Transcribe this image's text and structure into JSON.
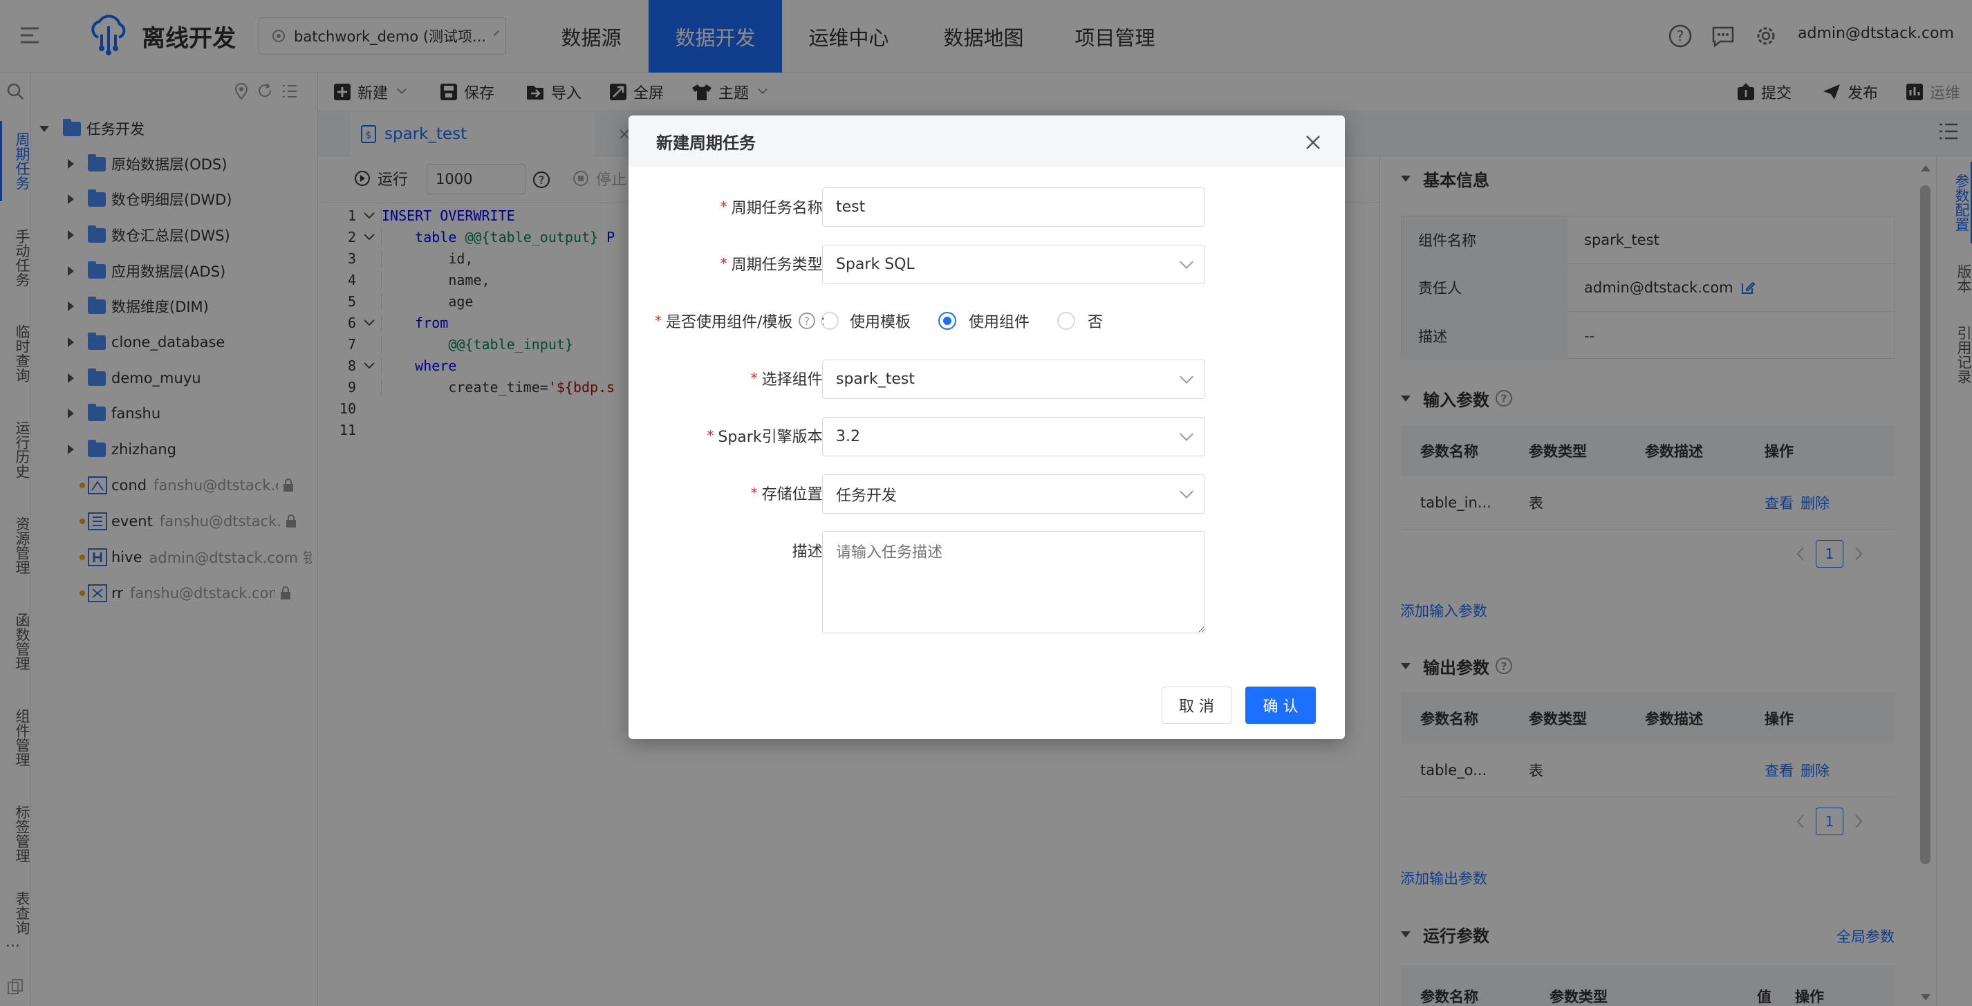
{
  "header": {
    "app_title": "离线开发",
    "project_selector": "batchwork_demo (测试项...",
    "nav": [
      {
        "label": "数据源"
      },
      {
        "label": "数据开发"
      },
      {
        "label": "运维中心"
      },
      {
        "label": "数据地图"
      },
      {
        "label": "项目管理"
      }
    ],
    "active_nav": "数据开发",
    "user": "admin@dtstack.com"
  },
  "left_rail": {
    "items": [
      {
        "label": "周期任务"
      },
      {
        "label": "手动任务"
      },
      {
        "label": "临时查询"
      },
      {
        "label": "运行历史"
      },
      {
        "label": "资源管理"
      },
      {
        "label": "函数管理"
      },
      {
        "label": "组件管理"
      },
      {
        "label": "标签管理"
      },
      {
        "label": "表查询"
      }
    ],
    "more": "..."
  },
  "tree": {
    "root": "任务开发",
    "folders": [
      {
        "label": "原始数据层(ODS)"
      },
      {
        "label": "数仓明细层(DWD)"
      },
      {
        "label": "数仓汇总层(DWS)"
      },
      {
        "label": "应用数据层(ADS)"
      },
      {
        "label": "数据维度(DIM)"
      },
      {
        "label": "clone_database"
      },
      {
        "label": "demo_muyu"
      },
      {
        "label": "fanshu"
      },
      {
        "label": "zhizhang"
      }
    ],
    "tasks": [
      {
        "name": "cond",
        "owner": "fanshu@dtstack.co..."
      },
      {
        "name": "event",
        "owner": "fanshu@dtstack.c..."
      },
      {
        "name": "hive",
        "owner": "admin@dtstack.com 锁..."
      },
      {
        "name": "rr",
        "owner": "fanshu@dtstack.com ..."
      }
    ]
  },
  "toolbar": {
    "new": "新建",
    "save": "保存",
    "import": "导入",
    "fullscreen": "全屏",
    "theme": "主题",
    "submit": "提交",
    "publish": "发布",
    "ops": "运维"
  },
  "editor": {
    "tab": "spark_test",
    "run": "运行",
    "limit": "1000",
    "stop": "停止",
    "lines": [
      {
        "n": "1",
        "t": [
          {
            "c": "kw",
            "v": "INSERT OVERWRITE"
          }
        ]
      },
      {
        "n": "2",
        "t": [
          {
            "c": "",
            "v": "    "
          },
          {
            "c": "kw",
            "v": "table"
          },
          {
            "c": "",
            "v": " "
          },
          {
            "c": "vr",
            "v": "@@{table_output}"
          },
          {
            "c": "kw",
            "v": " P"
          }
        ]
      },
      {
        "n": "3",
        "t": [
          {
            "c": "",
            "v": "        id,"
          }
        ]
      },
      {
        "n": "4",
        "t": [
          {
            "c": "",
            "v": "        name,"
          }
        ]
      },
      {
        "n": "5",
        "t": [
          {
            "c": "",
            "v": "        age"
          }
        ]
      },
      {
        "n": "6",
        "t": [
          {
            "c": "",
            "v": "    "
          },
          {
            "c": "kw",
            "v": "from"
          }
        ]
      },
      {
        "n": "7",
        "t": [
          {
            "c": "",
            "v": "        "
          },
          {
            "c": "vr",
            "v": "@@{table_input}"
          }
        ]
      },
      {
        "n": "8",
        "t": [
          {
            "c": "",
            "v": "    "
          },
          {
            "c": "kw",
            "v": "where"
          }
        ]
      },
      {
        "n": "9",
        "t": [
          {
            "c": "",
            "v": "        create_time="
          },
          {
            "c": "st",
            "v": "'${bdp.s"
          }
        ]
      },
      {
        "n": "10",
        "t": []
      },
      {
        "n": "11",
        "t": []
      }
    ]
  },
  "right_panel": {
    "basic_title": "基本信息",
    "basic": [
      {
        "k": "组件名称",
        "v": "spark_test"
      },
      {
        "k": "责任人",
        "v": "admin@dtstack.com"
      },
      {
        "k": "描述",
        "v": "--"
      }
    ],
    "input_title": "输入参数",
    "output_title": "输出参数",
    "param_headers": [
      "参数名称",
      "参数类型",
      "参数描述",
      "操作"
    ],
    "input_row": {
      "name": "table_in...",
      "type": "表",
      "view": "查看",
      "del": "删除"
    },
    "output_row": {
      "name": "table_o...",
      "type": "表",
      "view": "查看",
      "del": "删除"
    },
    "page": "1",
    "add_input": "添加输入参数",
    "add_output": "添加输出参数",
    "run_title": "运行参数",
    "global_params": "全局参数",
    "run_headers": [
      "参数名称",
      "参数类型",
      "值",
      "操作"
    ]
  },
  "right_rail": [
    {
      "label": "参数配置"
    },
    {
      "label": "版本"
    },
    {
      "label": "引用记录"
    }
  ],
  "modal": {
    "title": "新建周期任务",
    "fields": {
      "name_label": "周期任务名称",
      "name_value": "test",
      "type_label": "周期任务类型",
      "type_value": "Spark SQL",
      "use_label": "是否使用组件/模板",
      "opt_template": "使用模板",
      "opt_component": "使用组件",
      "opt_no": "否",
      "component_label": "选择组件",
      "component_value": "spark_test",
      "engine_label": "Spark引擎版本",
      "engine_value": "3.2",
      "location_label": "存储位置",
      "location_value": "任务开发",
      "desc_label": "描述",
      "desc_placeholder": "请输入任务描述"
    },
    "cancel": "取 消",
    "confirm": "确 认",
    "colon": ":"
  },
  "colors": {
    "accent": "#1d6fff",
    "required": "#f5222d",
    "mask": "rgba(0,0,0,0.45)"
  }
}
